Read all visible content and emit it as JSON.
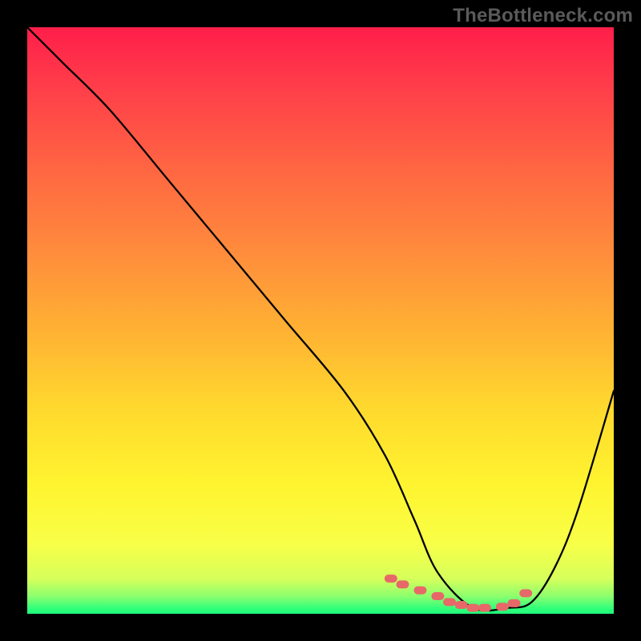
{
  "watermark": "TheBottleneck.com",
  "chart_data": {
    "type": "line",
    "title": "",
    "xlabel": "",
    "ylabel": "",
    "xlim": [
      0,
      100
    ],
    "ylim": [
      0,
      100
    ],
    "series": [
      {
        "name": "bottleneck-curve",
        "x": [
          0,
          6,
          14,
          24,
          34,
          44,
          54,
          61,
          66,
          70,
          76,
          82,
          86,
          90,
          94,
          100
        ],
        "values": [
          100,
          94,
          86,
          74,
          62,
          50,
          38,
          27,
          16,
          7,
          1,
          1,
          2,
          8,
          18,
          38
        ]
      }
    ],
    "markers": {
      "name": "highlighted-points",
      "color": "#e76868",
      "x": [
        62,
        64,
        67,
        70,
        72,
        74,
        76,
        78,
        81,
        83,
        85
      ],
      "values": [
        6,
        5,
        4,
        3,
        2,
        1.5,
        1,
        1,
        1.2,
        1.8,
        3.5
      ]
    }
  }
}
